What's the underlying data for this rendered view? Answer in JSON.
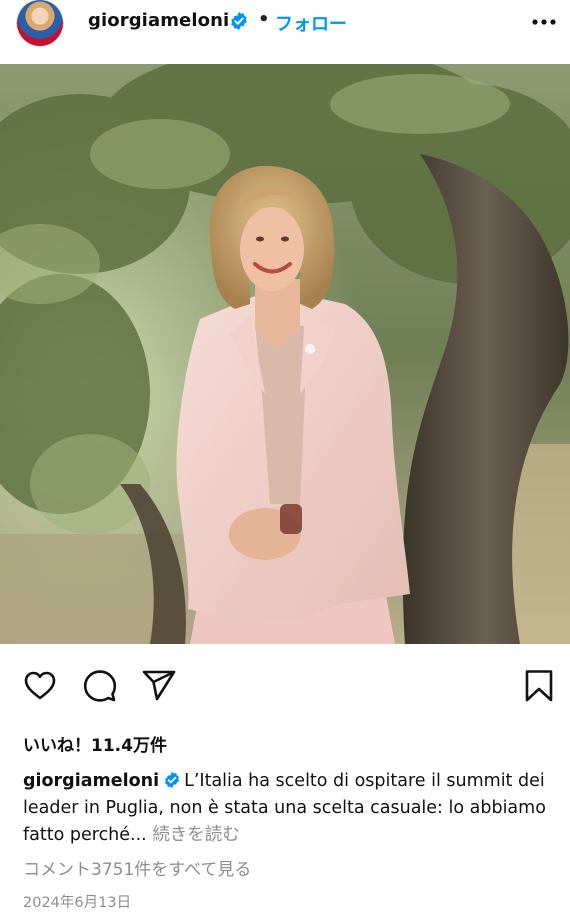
{
  "post": {
    "username": "giorgiameloni",
    "separator": "•",
    "follow_label": "フォロー",
    "likes_text": "いいね！11.4万件",
    "caption_text": "L’Italia ha scelto di ospitare il summit dei leader in Puglia, non è stata una scelta casuale: lo abbiamo fatto perché...",
    "more_label": "続きを読む",
    "view_comments_label": "コメント3751件をすべて見る",
    "date": "2024年6月13日"
  },
  "icons": {
    "verified": "verified-badge-icon",
    "more": "more-horizontal-icon",
    "like": "heart-icon",
    "comment": "comment-bubble-icon",
    "share": "paper-plane-icon",
    "save": "bookmark-icon"
  },
  "colors": {
    "link_blue": "#0095f6",
    "muted_text": "#8e8e8e",
    "verified_blue": "#0095f6"
  }
}
